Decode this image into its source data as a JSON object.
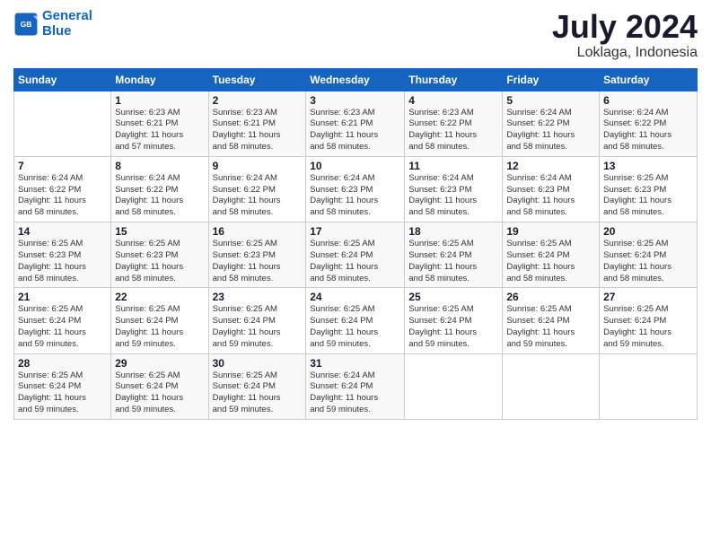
{
  "header": {
    "logo_line1": "General",
    "logo_line2": "Blue",
    "month": "July 2024",
    "location": "Loklaga, Indonesia"
  },
  "days_of_week": [
    "Sunday",
    "Monday",
    "Tuesday",
    "Wednesday",
    "Thursday",
    "Friday",
    "Saturday"
  ],
  "weeks": [
    [
      {
        "day": "",
        "info": ""
      },
      {
        "day": "1",
        "info": "Sunrise: 6:23 AM\nSunset: 6:21 PM\nDaylight: 11 hours\nand 57 minutes."
      },
      {
        "day": "2",
        "info": "Sunrise: 6:23 AM\nSunset: 6:21 PM\nDaylight: 11 hours\nand 58 minutes."
      },
      {
        "day": "3",
        "info": "Sunrise: 6:23 AM\nSunset: 6:21 PM\nDaylight: 11 hours\nand 58 minutes."
      },
      {
        "day": "4",
        "info": "Sunrise: 6:23 AM\nSunset: 6:22 PM\nDaylight: 11 hours\nand 58 minutes."
      },
      {
        "day": "5",
        "info": "Sunrise: 6:24 AM\nSunset: 6:22 PM\nDaylight: 11 hours\nand 58 minutes."
      },
      {
        "day": "6",
        "info": "Sunrise: 6:24 AM\nSunset: 6:22 PM\nDaylight: 11 hours\nand 58 minutes."
      }
    ],
    [
      {
        "day": "7",
        "info": "Sunrise: 6:24 AM\nSunset: 6:22 PM\nDaylight: 11 hours\nand 58 minutes."
      },
      {
        "day": "8",
        "info": "Sunrise: 6:24 AM\nSunset: 6:22 PM\nDaylight: 11 hours\nand 58 minutes."
      },
      {
        "day": "9",
        "info": "Sunrise: 6:24 AM\nSunset: 6:22 PM\nDaylight: 11 hours\nand 58 minutes."
      },
      {
        "day": "10",
        "info": "Sunrise: 6:24 AM\nSunset: 6:23 PM\nDaylight: 11 hours\nand 58 minutes."
      },
      {
        "day": "11",
        "info": "Sunrise: 6:24 AM\nSunset: 6:23 PM\nDaylight: 11 hours\nand 58 minutes."
      },
      {
        "day": "12",
        "info": "Sunrise: 6:24 AM\nSunset: 6:23 PM\nDaylight: 11 hours\nand 58 minutes."
      },
      {
        "day": "13",
        "info": "Sunrise: 6:25 AM\nSunset: 6:23 PM\nDaylight: 11 hours\nand 58 minutes."
      }
    ],
    [
      {
        "day": "14",
        "info": "Sunrise: 6:25 AM\nSunset: 6:23 PM\nDaylight: 11 hours\nand 58 minutes."
      },
      {
        "day": "15",
        "info": "Sunrise: 6:25 AM\nSunset: 6:23 PM\nDaylight: 11 hours\nand 58 minutes."
      },
      {
        "day": "16",
        "info": "Sunrise: 6:25 AM\nSunset: 6:23 PM\nDaylight: 11 hours\nand 58 minutes."
      },
      {
        "day": "17",
        "info": "Sunrise: 6:25 AM\nSunset: 6:24 PM\nDaylight: 11 hours\nand 58 minutes."
      },
      {
        "day": "18",
        "info": "Sunrise: 6:25 AM\nSunset: 6:24 PM\nDaylight: 11 hours\nand 58 minutes."
      },
      {
        "day": "19",
        "info": "Sunrise: 6:25 AM\nSunset: 6:24 PM\nDaylight: 11 hours\nand 58 minutes."
      },
      {
        "day": "20",
        "info": "Sunrise: 6:25 AM\nSunset: 6:24 PM\nDaylight: 11 hours\nand 58 minutes."
      }
    ],
    [
      {
        "day": "21",
        "info": "Sunrise: 6:25 AM\nSunset: 6:24 PM\nDaylight: 11 hours\nand 59 minutes."
      },
      {
        "day": "22",
        "info": "Sunrise: 6:25 AM\nSunset: 6:24 PM\nDaylight: 11 hours\nand 59 minutes."
      },
      {
        "day": "23",
        "info": "Sunrise: 6:25 AM\nSunset: 6:24 PM\nDaylight: 11 hours\nand 59 minutes."
      },
      {
        "day": "24",
        "info": "Sunrise: 6:25 AM\nSunset: 6:24 PM\nDaylight: 11 hours\nand 59 minutes."
      },
      {
        "day": "25",
        "info": "Sunrise: 6:25 AM\nSunset: 6:24 PM\nDaylight: 11 hours\nand 59 minutes."
      },
      {
        "day": "26",
        "info": "Sunrise: 6:25 AM\nSunset: 6:24 PM\nDaylight: 11 hours\nand 59 minutes."
      },
      {
        "day": "27",
        "info": "Sunrise: 6:25 AM\nSunset: 6:24 PM\nDaylight: 11 hours\nand 59 minutes."
      }
    ],
    [
      {
        "day": "28",
        "info": "Sunrise: 6:25 AM\nSunset: 6:24 PM\nDaylight: 11 hours\nand 59 minutes."
      },
      {
        "day": "29",
        "info": "Sunrise: 6:25 AM\nSunset: 6:24 PM\nDaylight: 11 hours\nand 59 minutes."
      },
      {
        "day": "30",
        "info": "Sunrise: 6:25 AM\nSunset: 6:24 PM\nDaylight: 11 hours\nand 59 minutes."
      },
      {
        "day": "31",
        "info": "Sunrise: 6:24 AM\nSunset: 6:24 PM\nDaylight: 11 hours\nand 59 minutes."
      },
      {
        "day": "",
        "info": ""
      },
      {
        "day": "",
        "info": ""
      },
      {
        "day": "",
        "info": ""
      }
    ]
  ]
}
